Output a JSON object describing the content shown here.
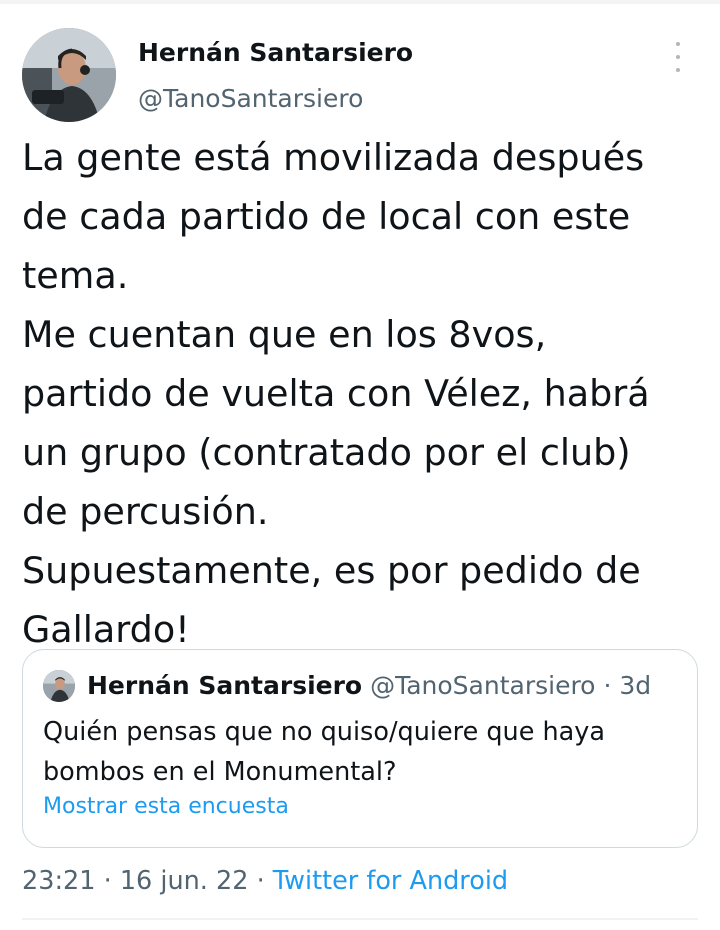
{
  "tweet": {
    "author": {
      "display_name": "Hernán Santarsiero",
      "handle": "@TanoSantarsiero"
    },
    "text": "La gente está movilizada después\nde cada partido de local con este\ntema.\nMe cuentan que en los 8vos,\npartido de vuelta con Vélez, habrá\nun grupo (contratado por el club)\nde percusión.\nSupuestamente, es por pedido de\nGallardo!",
    "time": "23:21",
    "date": "16 jun. 22",
    "source": "Twitter for Android",
    "separator": "·"
  },
  "quoted_tweet": {
    "display_name": "Hernán Santarsiero",
    "handle": "@TanoSantarsiero",
    "separator": "·",
    "age": "3d",
    "text": "Quién pensas que no quiso/quiere que haya bombos en el Monumental?",
    "poll_link": "Mostrar esta encuesta"
  },
  "icons": {
    "more": "more-vertical-icon",
    "avatar": "avatar"
  },
  "colors": {
    "primary_text": "#0f1419",
    "secondary_text": "#536471",
    "link": "#1d9bf0",
    "border": "#cfd9de"
  }
}
